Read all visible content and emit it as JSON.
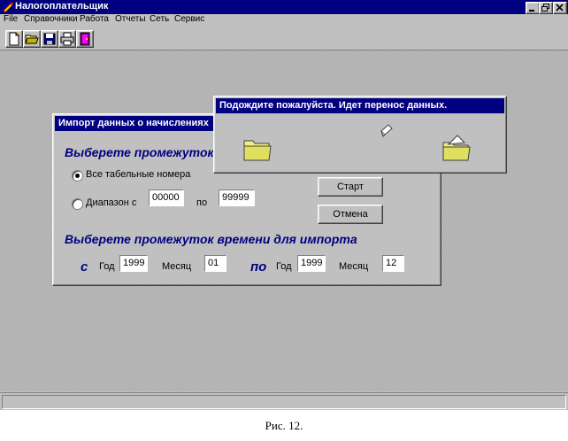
{
  "window": {
    "title": "Налогоплательщик"
  },
  "menu": [
    "File",
    "Справочники",
    "Работа",
    "Отчеты",
    "Сеть",
    "Сервис"
  ],
  "toolbar": {
    "icons": [
      "new-document-icon",
      "open-folder-icon",
      "save-disk-icon",
      "print-icon",
      "exit-door-icon"
    ]
  },
  "import_dialog": {
    "title": "Импорт данных о начислениях",
    "section_numbers": "Выберете промежуток",
    "radio_all": "Все табельные номера",
    "radio_range": "Диапазон с",
    "range_from": "00000",
    "range_to_label": "по",
    "range_to": "99999",
    "start_button": "Старт",
    "cancel_button": "Отмена",
    "section_time": "Выберете промежуток времени для импорта",
    "from_label": "с",
    "to_label": "по",
    "year_label": "Год",
    "month_label": "Месяц",
    "from_year": "1999",
    "from_month": "01",
    "to_year": "1999",
    "to_month": "12"
  },
  "progress": {
    "title": "Подождите пожалуйста. Идет перенос данных."
  },
  "caption": "Рис. 12.",
  "colors": {
    "titlebar": "#000080",
    "face": "#c0c0c0",
    "section_text": "#000080"
  }
}
